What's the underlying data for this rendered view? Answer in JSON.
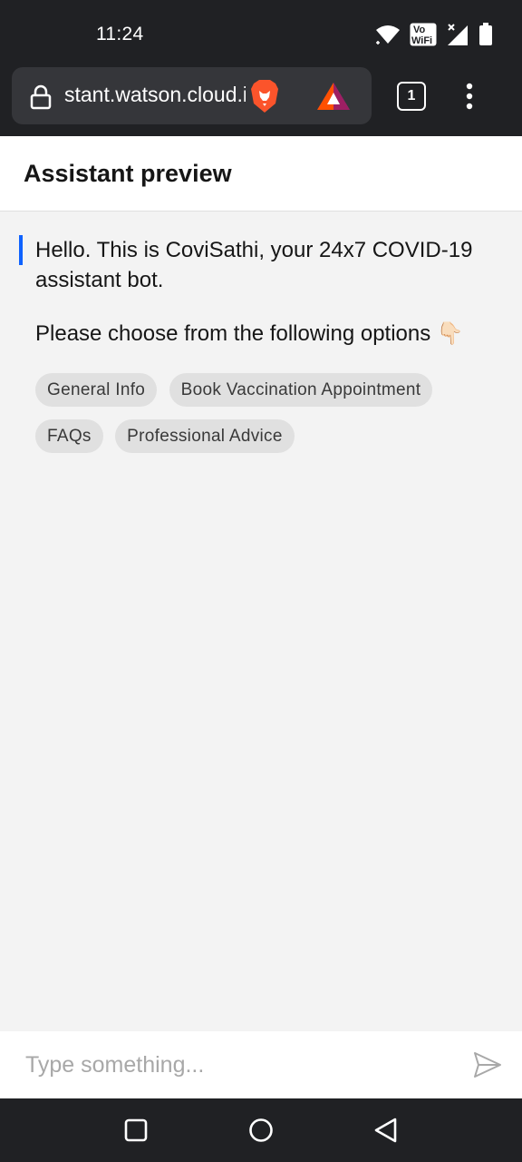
{
  "status_bar": {
    "time": "11:24",
    "icons": [
      "wifi-icon",
      "vowifi-icon",
      "cell-signal-icon",
      "battery-icon"
    ],
    "vowifi_top": "Vo",
    "vowifi_bottom": "WiFi"
  },
  "browser": {
    "url": "stant.watson.cloud.ibm.com",
    "tab_count": "1",
    "icons": [
      "lock-icon",
      "brave-shields-icon",
      "bat-rewards-icon",
      "tabs-icon",
      "more-menu-icon"
    ]
  },
  "header": {
    "title": "Assistant preview"
  },
  "chat": {
    "messages": [
      {
        "text": "Hello. This is CoviSathi, your 24x7 COVID-19 assistant bot."
      },
      {
        "text": "Please choose from the following options 👇🏻"
      }
    ],
    "options": [
      "General Info",
      "Book Vaccination Appointment",
      "FAQs",
      "Professional Advice"
    ]
  },
  "composer": {
    "placeholder": "Type something...",
    "value": ""
  },
  "nav": {
    "icons": [
      "recents-square-icon",
      "home-circle-icon",
      "back-triangle-icon"
    ]
  },
  "colors": {
    "accent": "#0f62fe",
    "system_bar": "#202124",
    "chat_background": "#f3f3f3",
    "chip_background": "#e0e0e0"
  }
}
